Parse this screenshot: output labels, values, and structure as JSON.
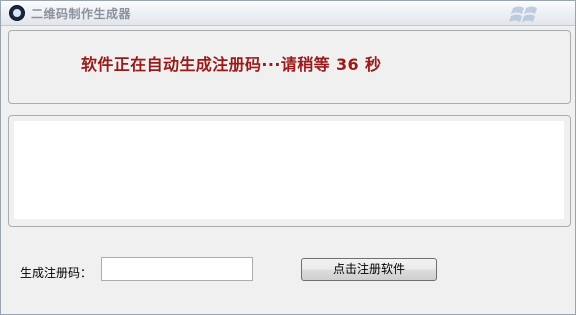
{
  "window": {
    "title": "二维码制作生成器"
  },
  "status": {
    "message": "软件正在自动生成注册码···请稍等 36 秒"
  },
  "form": {
    "code_label": "生成注册码：",
    "code_value": "",
    "register_button": "点击注册软件"
  },
  "icons": {
    "app": "app-logo-icon",
    "windows": "windows-logo-icon"
  },
  "colors": {
    "message": "#9a1a1a",
    "background": "#f0f0f0"
  }
}
